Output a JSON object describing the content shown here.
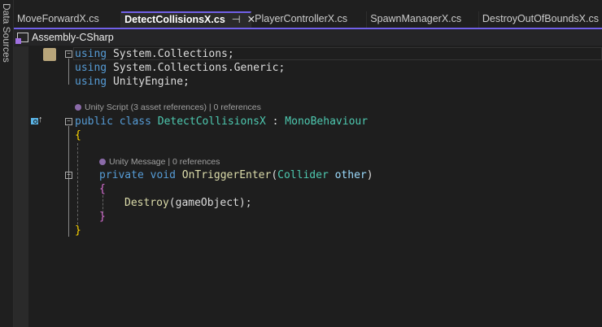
{
  "side_panel": {
    "label": "Data Sources"
  },
  "tabs": [
    {
      "label": "MoveForwardX.cs"
    },
    {
      "label": "DetectCollisionsX.cs",
      "active": true
    },
    {
      "label": "PlayerControllerX.cs"
    },
    {
      "label": "SpawnManagerX.cs"
    },
    {
      "label": "DestroyOutOfBoundsX.cs"
    }
  ],
  "tab_icons": {
    "pin": "⊣",
    "close": "✕"
  },
  "project": "Assembly-CSharp",
  "code": {
    "l1": [
      "using",
      " System.Collections;"
    ],
    "l2": [
      "using",
      " System.Collections.Generic;"
    ],
    "l3": [
      "using",
      " UnityEngine;"
    ],
    "lens1": "Unity Script (3 asset references) | 0 references",
    "l4": [
      "public class ",
      "DetectCollisionsX",
      " : ",
      "MonoBehaviour"
    ],
    "l5": "{",
    "lens2": "Unity Message | 0 references",
    "l6": [
      "private void ",
      "OnTriggerEnter",
      "(",
      "Collider",
      " other",
      ")"
    ],
    "l7": "{",
    "l8": [
      "Destroy",
      "(gameObject);"
    ],
    "l9": "}",
    "l10": "}"
  },
  "colors": {
    "accent": "#7160e8",
    "keyword": "#569cd6",
    "type": "#4ec9b0",
    "method": "#dcdcaa"
  }
}
